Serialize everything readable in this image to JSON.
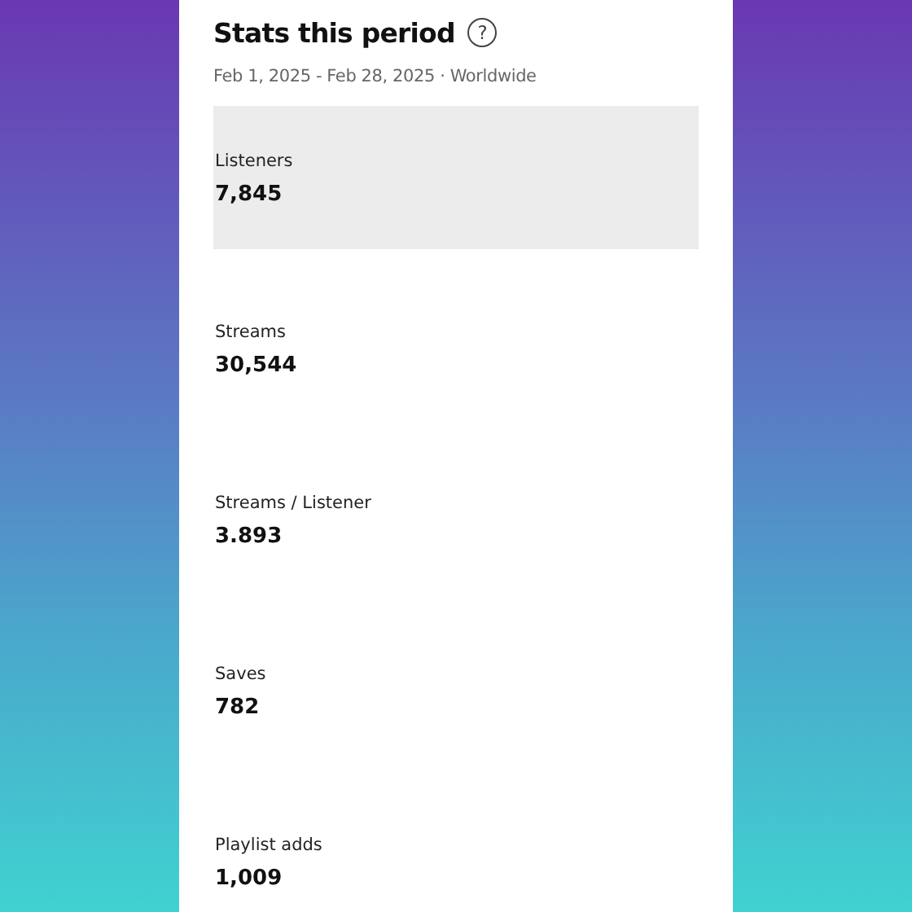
{
  "header": {
    "title": "Stats this period",
    "help_icon": "?",
    "subtitle": "Feb 1, 2025 - Feb 28, 2025 · Worldwide"
  },
  "stats": [
    {
      "label": "Listeners",
      "value": "7,845",
      "selected": true
    },
    {
      "label": "Streams",
      "value": "30,544",
      "selected": false
    },
    {
      "label": "Streams / Listener",
      "value": "3.893",
      "selected": false
    },
    {
      "label": "Saves",
      "value": "782",
      "selected": false
    },
    {
      "label": "Playlist adds",
      "value": "1,009",
      "selected": false
    }
  ]
}
